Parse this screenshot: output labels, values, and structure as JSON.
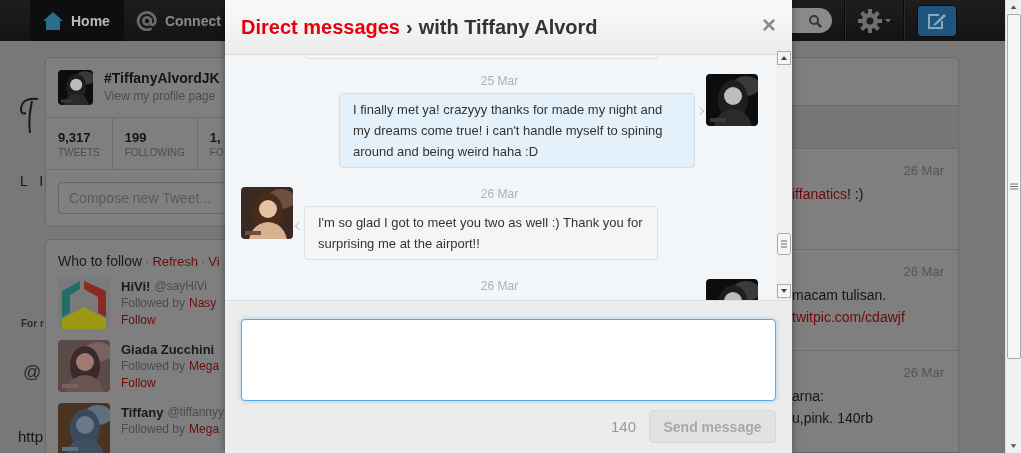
{
  "topbar": {
    "nav": [
      {
        "kind": "home",
        "label": "Home",
        "selected": true
      },
      {
        "kind": "connect",
        "label": "Connect",
        "selected": false
      }
    ]
  },
  "background": {
    "fragments": [
      "L I",
      "For r",
      "@",
      "http"
    ]
  },
  "profile": {
    "name": "#TiffanyAlvordJK",
    "link": "View my profile page",
    "stats": [
      {
        "value": "9,317",
        "label": "TWEETS"
      },
      {
        "value": "199",
        "label": "FOLLOWING"
      },
      {
        "value": "1,",
        "label": "FO"
      }
    ],
    "compose": {
      "placeholder": "Compose new Tweet..."
    }
  },
  "who_to_follow": {
    "title": "Who to follow",
    "links": [
      {
        "separator": "·",
        "label": "Refresh"
      },
      {
        "separator": "·",
        "label": "Vi"
      }
    ],
    "users": [
      {
        "kind": "logo",
        "name": "HiVi!",
        "handle": "@sayHiVi",
        "followed_by": "Followed by",
        "follower": "Nasy",
        "action": "Follow"
      },
      {
        "name": "Giada Zucchini",
        "followed_by": "Followed by",
        "follower": "Mega",
        "action": "Follow"
      },
      {
        "name": "Tiffany",
        "handle": "@tiffannyy",
        "followed_by": "Followed by",
        "follower": "Mega"
      }
    ]
  },
  "dialog": {
    "title": "Direct messages",
    "separator": "›",
    "subtitle": "with Tiffany Alvord",
    "close": "×",
    "messages": [
      {
        "kind": "sent",
        "date": "25 Mar",
        "text": "I finally met ya! crazyyy thanks for made my night and my dreams come true! i can't handle myself to spining around and being weird haha :D"
      },
      {
        "kind": "received",
        "date": "26 Mar",
        "text": "I'm so glad I got to meet you two as well :) Thank you for surprising me at the airport!!"
      },
      {
        "kind": "sent",
        "date": "26 Mar"
      }
    ],
    "reply": {
      "counter": "140",
      "button": "Send message",
      "disabled": true
    }
  },
  "timeline": {
    "tweets": [
      {
        "date": "26 Mar",
        "lines": [
          [
            {
              "text": "iffanatics",
              "link": true
            },
            {
              "text": "! :)",
              "link": false
            }
          ]
        ]
      },
      {
        "date": "26 Mar",
        "lines": [
          [
            {
              "text": "macam tulisan.",
              "link": false
            }
          ],
          [
            {
              "text": "twitpic.com/cdawjf",
              "link": true
            }
          ]
        ]
      },
      {
        "date": "26 Mar",
        "lines": [
          [
            {
              "text": "arna:",
              "link": false
            }
          ],
          [
            {
              "text": "u,pink. 140rb",
              "link": false
            }
          ]
        ]
      }
    ]
  }
}
